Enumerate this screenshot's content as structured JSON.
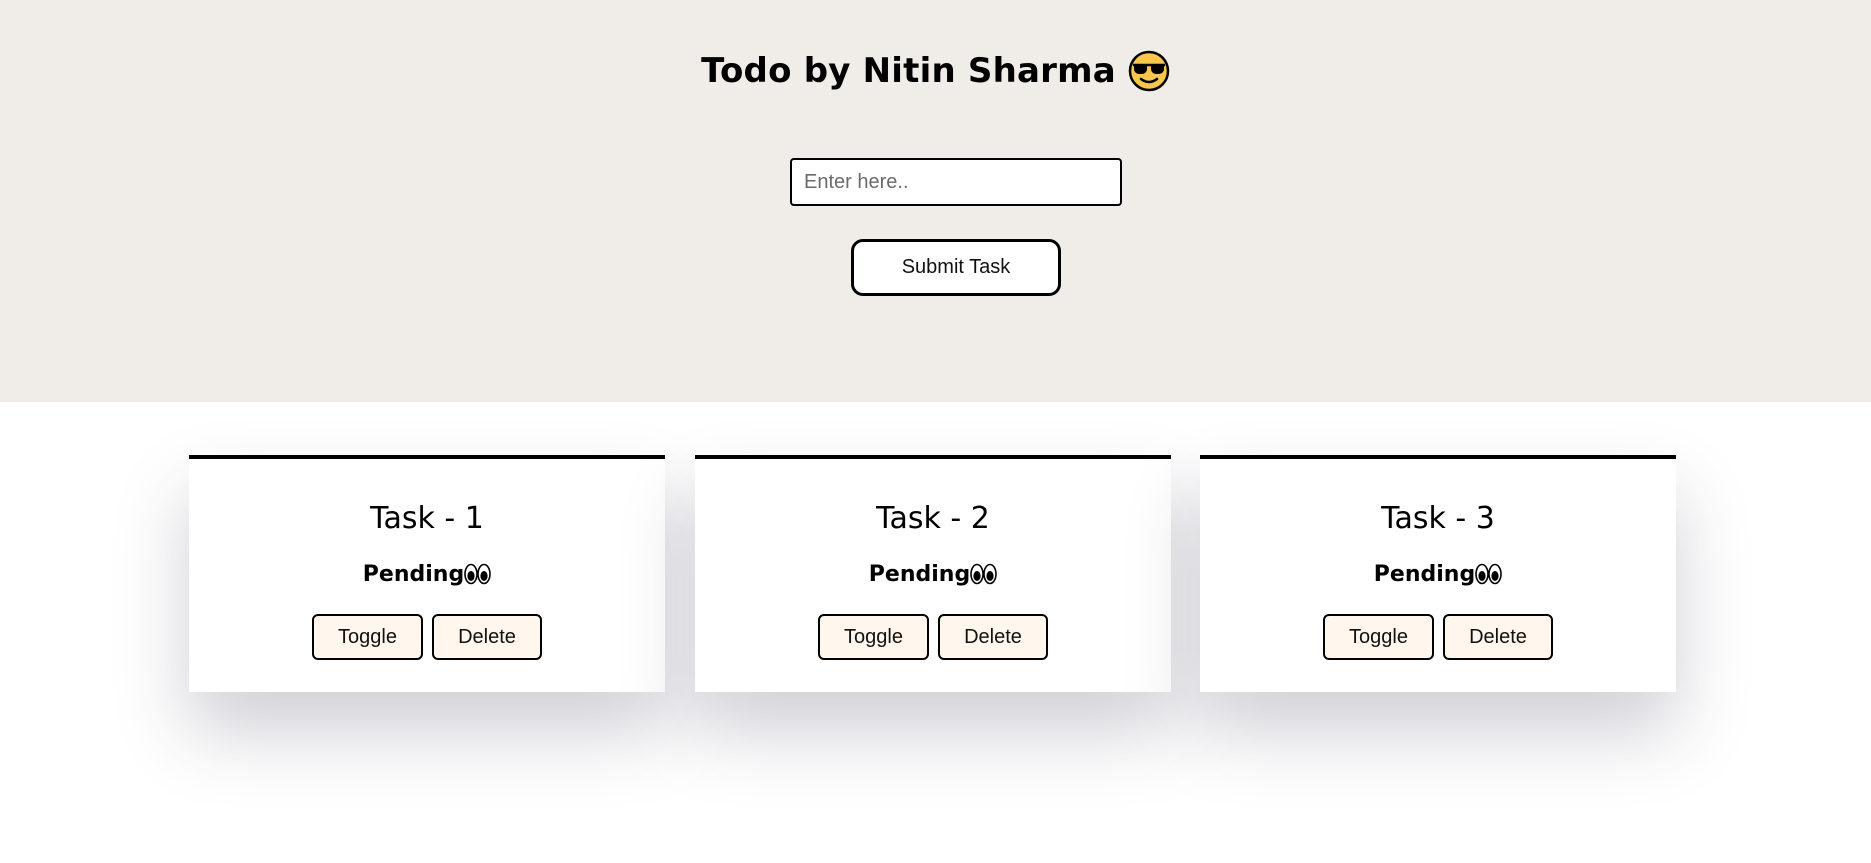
{
  "header": {
    "title": "Todo by Nitin Sharma",
    "title_icon": "sunglasses-face-icon",
    "input_placeholder": "Enter here..",
    "input_value": "",
    "submit_label": "Submit Task"
  },
  "tasks": [
    {
      "title": "Task - 1",
      "status": "Pending",
      "status_icon": "eyes-icon",
      "toggle_label": "Toggle",
      "delete_label": "Delete"
    },
    {
      "title": "Task - 2",
      "status": "Pending",
      "status_icon": "eyes-icon",
      "toggle_label": "Toggle",
      "delete_label": "Delete"
    },
    {
      "title": "Task - 3",
      "status": "Pending",
      "status_icon": "eyes-icon",
      "toggle_label": "Toggle",
      "delete_label": "Delete"
    }
  ],
  "colors": {
    "header_background": "#f0ece7",
    "card_button_background": "#fff6ed",
    "border": "#000000"
  }
}
